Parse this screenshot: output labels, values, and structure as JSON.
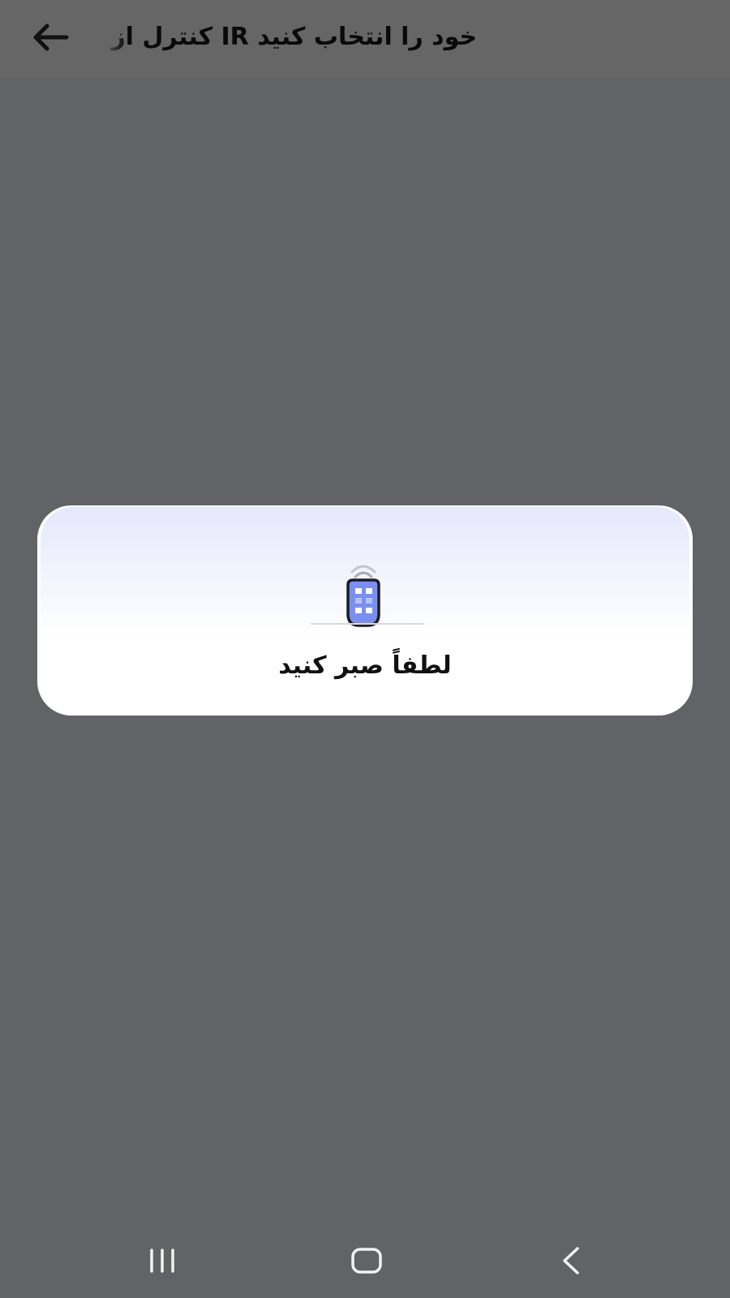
{
  "app_bar": {
    "back_icon": "arrow-left-icon",
    "title": "خود را انتخاب کنید IR کنترل از"
  },
  "dialog": {
    "icon": "ir-remote-icon",
    "message": "لطفاً صبر کنید",
    "accent_color": "#7b8ff0"
  },
  "nav_bar": {
    "recents_icon": "recents-icon",
    "home_icon": "home-icon",
    "back_icon": "chevron-left-icon"
  }
}
